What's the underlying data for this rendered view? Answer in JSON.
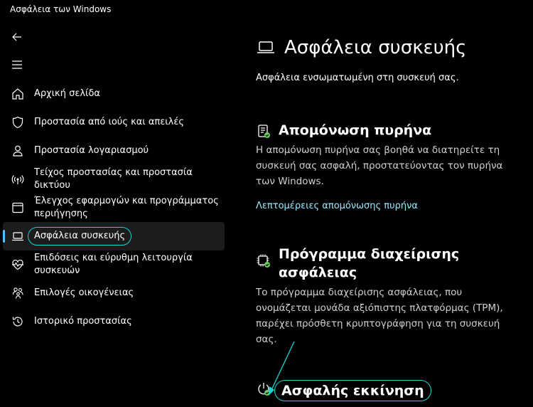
{
  "window": {
    "title": "Ασφάλεια των Windows"
  },
  "sidebar": {
    "items": [
      {
        "label": "Αρχική σελίδα",
        "icon": "home-icon"
      },
      {
        "label": "Προστασία από ιούς και απειλές",
        "icon": "shield-icon"
      },
      {
        "label": "Προστασία λογαριασμού",
        "icon": "person-icon"
      },
      {
        "label": "Τείχος προστασίας και προστασία δικτύου",
        "icon": "wifi-antenna-icon"
      },
      {
        "label": "Έλεγχος εφαρμογών και προγράμματος περιήγησης",
        "icon": "app-window-icon"
      },
      {
        "label": "Ασφάλεια συσκευής",
        "icon": "laptop-icon",
        "active": true
      },
      {
        "label": "Επιδόσεις και εύρυθμη λειτουργία συσκευών",
        "icon": "heart-pulse-icon"
      },
      {
        "label": "Επιλογές οικογένειας",
        "icon": "family-icon"
      },
      {
        "label": "Ιστορικό προστασίας",
        "icon": "history-icon"
      }
    ]
  },
  "main": {
    "title": "Ασφάλεια συσκευής",
    "subtitle": "Ασφάλεια ενσωματωμένη στη συσκευή σας.",
    "core_isolation": {
      "title": "Απομόνωση πυρήνα",
      "description": "Η απομόνωση πυρήνα σας βοηθά να διατηρείτε τη συσκευή σας ασφαλή, προστατεύοντας τον πυρήνα των Windows.",
      "link": "Λεπτομέρειες απομόνωσης πυρήνα"
    },
    "security_processor": {
      "title": "Πρόγραμμα διαχείρισης ασφάλειας",
      "description": "Το πρόγραμμα διαχείρισης ασφάλειας, που ονομάζεται μονάδα αξιόπιστης πλατφόρμας (TPM), παρέχει πρόσθετη κρυπτογράφηση για τη συσκευή σας."
    },
    "secure_boot": {
      "title": "Ασφαλής εκκίνηση"
    }
  },
  "colors": {
    "accent": "#4cc2ff",
    "highlight": "#19d3d3",
    "check": "#6ccb5f",
    "link": "#99ebff"
  }
}
